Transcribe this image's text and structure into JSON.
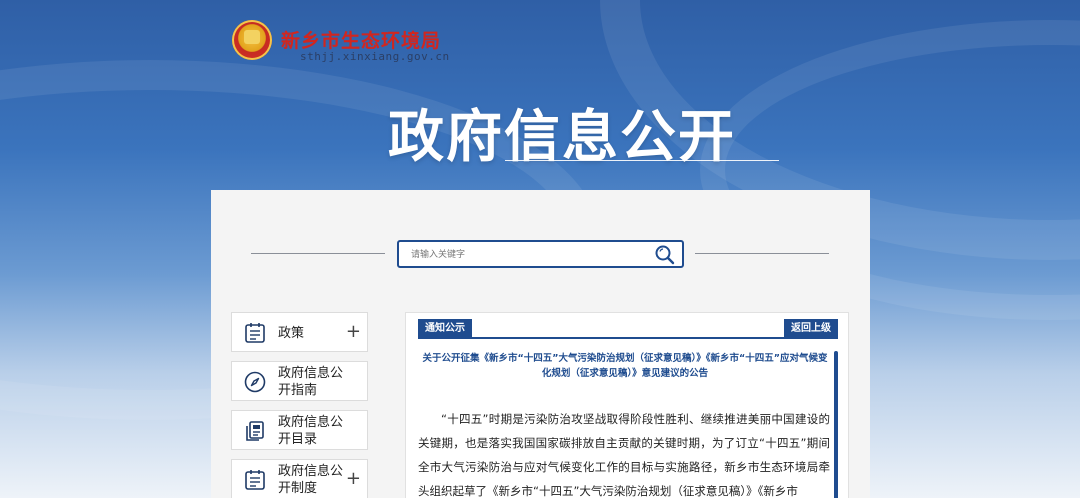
{
  "header": {
    "site_name": "新乡市生态环境局",
    "site_domain": "sthjj.xinxiang.gov.cn",
    "page_title": "政府信息公开"
  },
  "search": {
    "placeholder": "请输入关键字"
  },
  "sidebar": {
    "items": [
      {
        "label": "政策",
        "icon": "calendar-list-icon",
        "expandable": true
      },
      {
        "label": "政府信息公开指南",
        "icon": "compass-icon",
        "expandable": false
      },
      {
        "label": "政府信息公开目录",
        "icon": "document-icon",
        "expandable": false
      },
      {
        "label": "政府信息公开制度",
        "icon": "calendar-list-icon",
        "expandable": true
      }
    ]
  },
  "main": {
    "tab_label": "通知公示",
    "back_label": "返回上级",
    "article_title": "关于公开征集《新乡市“十四五”大气污染防治规划（征求意见稿）》《新乡市“十四五”应对气候变化规划（征求意见稿）》意见建议的公告",
    "article_body": "“十四五”时期是污染防治攻坚战取得阶段性胜利、继续推进美丽中国建设的关键期，也是落实我国国家碳排放自主贡献的关键时期，为了订立“十四五”期间全市大气污染防治与应对气候变化工作的目标与实施路径，新乡市生态环境局牵头组织起草了《新乡市“十四五”大气污染防治规划（征求意见稿）》《新乡市"
  },
  "colors": {
    "accent": "#1f4c8f",
    "brand_red": "#d1261f"
  }
}
